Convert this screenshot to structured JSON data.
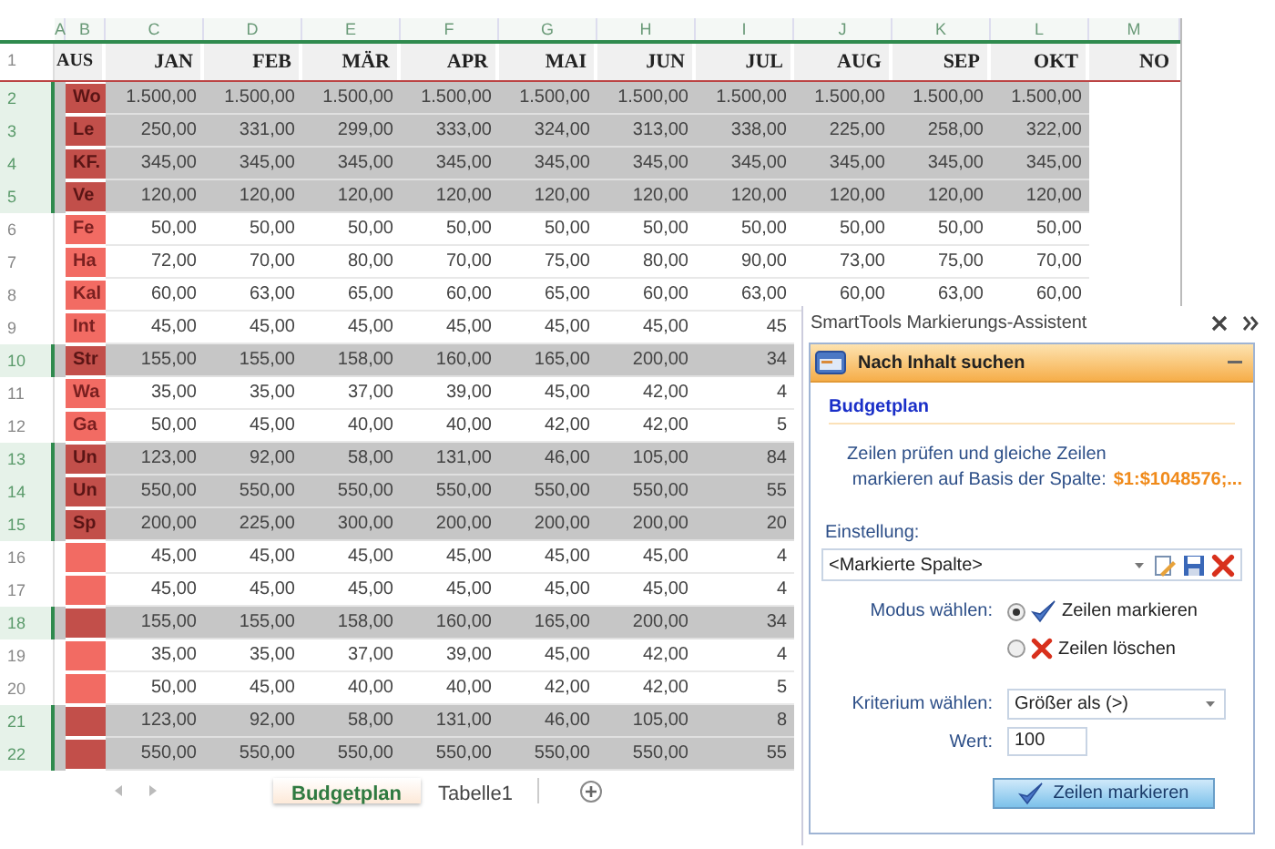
{
  "columns": [
    "A",
    "B",
    "C",
    "D",
    "E",
    "F",
    "G",
    "H",
    "I",
    "J",
    "K",
    "L",
    "M"
  ],
  "header": {
    "number": "1",
    "cells": [
      "AUS",
      "JAN",
      "FEB",
      "MÄR",
      "APR",
      "MAI",
      "JUN",
      "JUL",
      "AUG",
      "SEP",
      "OKT",
      "NO"
    ]
  },
  "rows": [
    {
      "number": "2",
      "marked": true,
      "label": "Wo",
      "values": [
        "1.500,00",
        "1.500,00",
        "1.500,00",
        "1.500,00",
        "1.500,00",
        "1.500,00",
        "1.500,00",
        "1.500,00",
        "1.500,00",
        "1.500,00"
      ]
    },
    {
      "number": "3",
      "marked": true,
      "label": "Le",
      "values": [
        "250,00",
        "331,00",
        "299,00",
        "333,00",
        "324,00",
        "313,00",
        "338,00",
        "225,00",
        "258,00",
        "322,00"
      ]
    },
    {
      "number": "4",
      "marked": true,
      "label": "KF.",
      "values": [
        "345,00",
        "345,00",
        "345,00",
        "345,00",
        "345,00",
        "345,00",
        "345,00",
        "345,00",
        "345,00",
        "345,00"
      ]
    },
    {
      "number": "5",
      "marked": true,
      "label": "Ve",
      "values": [
        "120,00",
        "120,00",
        "120,00",
        "120,00",
        "120,00",
        "120,00",
        "120,00",
        "120,00",
        "120,00",
        "120,00"
      ]
    },
    {
      "number": "6",
      "marked": false,
      "label": "Fe",
      "values": [
        "50,00",
        "50,00",
        "50,00",
        "50,00",
        "50,00",
        "50,00",
        "50,00",
        "50,00",
        "50,00",
        "50,00"
      ]
    },
    {
      "number": "7",
      "marked": false,
      "label": "Ha",
      "values": [
        "72,00",
        "70,00",
        "80,00",
        "70,00",
        "75,00",
        "80,00",
        "90,00",
        "73,00",
        "75,00",
        "70,00"
      ]
    },
    {
      "number": "8",
      "marked": false,
      "label": "Kal",
      "values": [
        "60,00",
        "63,00",
        "65,00",
        "60,00",
        "65,00",
        "60,00",
        "63,00",
        "60,00",
        "63,00",
        "60,00"
      ]
    },
    {
      "number": "9",
      "marked": false,
      "label": "Int",
      "values": [
        "45,00",
        "45,00",
        "45,00",
        "45,00",
        "45,00",
        "45,00",
        "45"
      ]
    },
    {
      "number": "10",
      "marked": true,
      "label": "Str",
      "values": [
        "155,00",
        "155,00",
        "158,00",
        "160,00",
        "165,00",
        "200,00",
        "34"
      ]
    },
    {
      "number": "11",
      "marked": false,
      "label": "Wa",
      "values": [
        "35,00",
        "35,00",
        "37,00",
        "39,00",
        "45,00",
        "42,00",
        "4"
      ]
    },
    {
      "number": "12",
      "marked": false,
      "label": "Ga",
      "values": [
        "50,00",
        "45,00",
        "40,00",
        "40,00",
        "42,00",
        "42,00",
        "5"
      ]
    },
    {
      "number": "13",
      "marked": true,
      "label": "Un",
      "values": [
        "123,00",
        "92,00",
        "58,00",
        "131,00",
        "46,00",
        "105,00",
        "84"
      ]
    },
    {
      "number": "14",
      "marked": true,
      "label": "Un",
      "values": [
        "550,00",
        "550,00",
        "550,00",
        "550,00",
        "550,00",
        "550,00",
        "55"
      ]
    },
    {
      "number": "15",
      "marked": true,
      "label": "Sp",
      "values": [
        "200,00",
        "225,00",
        "300,00",
        "200,00",
        "200,00",
        "200,00",
        "20"
      ]
    },
    {
      "number": "16",
      "marked": false,
      "values": [
        "45,00",
        "45,00",
        "45,00",
        "45,00",
        "45,00",
        "45,00",
        "4"
      ]
    },
    {
      "number": "17",
      "marked": false,
      "values": [
        "45,00",
        "45,00",
        "45,00",
        "45,00",
        "45,00",
        "45,00",
        "4"
      ]
    },
    {
      "number": "18",
      "marked": true,
      "values": [
        "155,00",
        "155,00",
        "158,00",
        "160,00",
        "165,00",
        "200,00",
        "34"
      ]
    },
    {
      "number": "19",
      "marked": false,
      "values": [
        "35,00",
        "35,00",
        "37,00",
        "39,00",
        "45,00",
        "42,00",
        "4"
      ]
    },
    {
      "number": "20",
      "marked": false,
      "values": [
        "50,00",
        "45,00",
        "40,00",
        "40,00",
        "42,00",
        "42,00",
        "5"
      ]
    },
    {
      "number": "21",
      "marked": true,
      "values": [
        "123,00",
        "92,00",
        "58,00",
        "131,00",
        "46,00",
        "105,00",
        "8"
      ]
    },
    {
      "number": "22",
      "marked": true,
      "values": [
        "550,00",
        "550,00",
        "550,00",
        "550,00",
        "550,00",
        "550,00",
        "55"
      ]
    }
  ],
  "sheet_tabs": [
    {
      "label": "Budgetplan",
      "selected": true
    },
    {
      "label": "Tabelle1",
      "selected": false
    }
  ],
  "panel": {
    "title": "SmartTools Markierungs-Assistent",
    "section": "Nach Inhalt suchen",
    "sheet": "Budgetplan",
    "description": "Zeilen prüfen und gleiche Zeilen markieren auf Basis der Spalte:",
    "range": "$1:$1048576;...",
    "setting_label": "Einstellung:",
    "setting_value": "<Markierte Spalte>",
    "mode_label": "Modus wählen:",
    "modes": [
      {
        "label": "Zeilen markieren",
        "kind": "mark",
        "selected": true
      },
      {
        "label": "Zeilen löschen",
        "kind": "delete",
        "selected": false
      }
    ],
    "criterion_label": "Kriterium wählen:",
    "criterion_value": "Größer als (>)",
    "value_label": "Wert:",
    "value": "100",
    "action": "Zeilen markieren"
  }
}
